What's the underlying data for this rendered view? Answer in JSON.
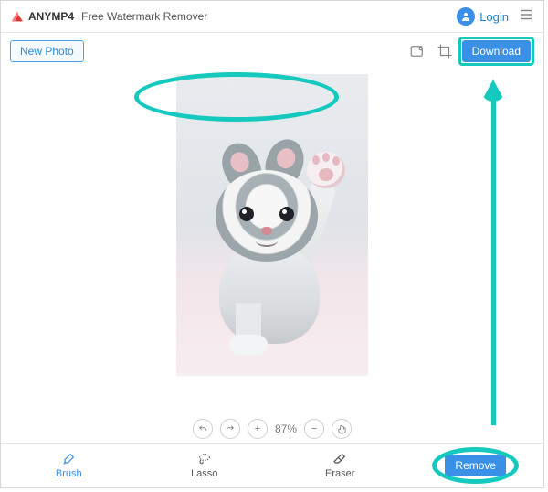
{
  "header": {
    "brand": "ANYMP4",
    "app_title": "Free Watermark Remover",
    "login_label": "Login"
  },
  "toolbar": {
    "new_photo_label": "New Photo",
    "download_label": "Download"
  },
  "zoom": {
    "value": "87%"
  },
  "tools": {
    "brush": "Brush",
    "lasso": "Lasso",
    "eraser": "Eraser"
  },
  "actions": {
    "remove_label": "Remove"
  }
}
